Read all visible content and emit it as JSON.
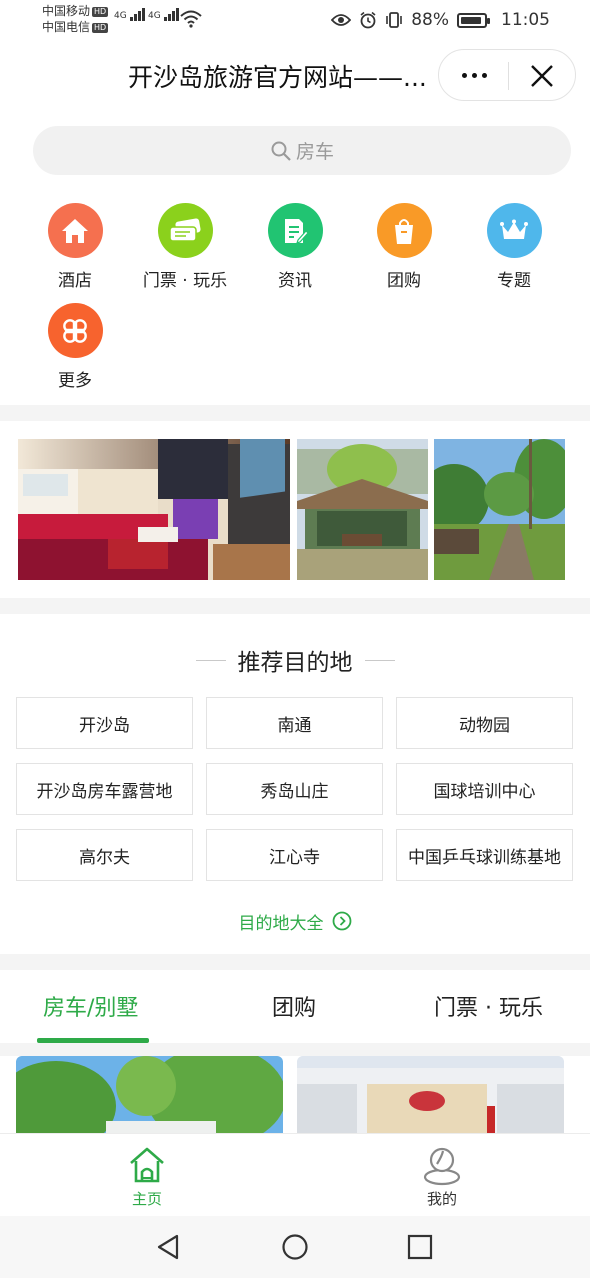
{
  "status_bar": {
    "carrier1": "中国移动",
    "carrier2": "中国电信",
    "hd": "HD",
    "network1": "4G",
    "network2": "4G",
    "battery": "88%",
    "time": "11:05"
  },
  "title_bar": {
    "title": "开沙岛旅游官方网站——..."
  },
  "search": {
    "placeholder": "房车"
  },
  "categories": [
    {
      "label": "酒店",
      "icon": "home-icon",
      "color": "#f5704f"
    },
    {
      "label": "门票 · 玩乐",
      "icon": "ticket-icon",
      "color": "#8bd11c"
    },
    {
      "label": "资讯",
      "icon": "document-edit-icon",
      "color": "#21c472"
    },
    {
      "label": "团购",
      "icon": "shopping-bag-icon",
      "color": "#f99a27"
    },
    {
      "label": "专题",
      "icon": "crown-icon",
      "color": "#4fb7eb"
    },
    {
      "label": "更多",
      "icon": "clover-icon",
      "color": "#f7632e"
    }
  ],
  "recommend": {
    "title": "推荐目的地",
    "destinations": [
      "开沙岛",
      "南通",
      "动物园",
      "开沙岛房车露营地",
      "秀岛山庄",
      "国球培训中心",
      "高尔夫",
      "江心寺",
      "中国乒乓球训练基地"
    ],
    "all_link": "目的地大全"
  },
  "tabs": [
    {
      "label": "房车/别墅",
      "active": true
    },
    {
      "label": "团购",
      "active": false
    },
    {
      "label": "门票 · 玩乐",
      "active": false
    }
  ],
  "bottom_nav": [
    {
      "label": "主页",
      "icon": "home-outline-icon",
      "active": true
    },
    {
      "label": "我的",
      "icon": "profile-icon",
      "active": false
    }
  ],
  "colors": {
    "accent": "#2eaa48",
    "background": "#ffffff",
    "divider": "#f4f4f4"
  }
}
